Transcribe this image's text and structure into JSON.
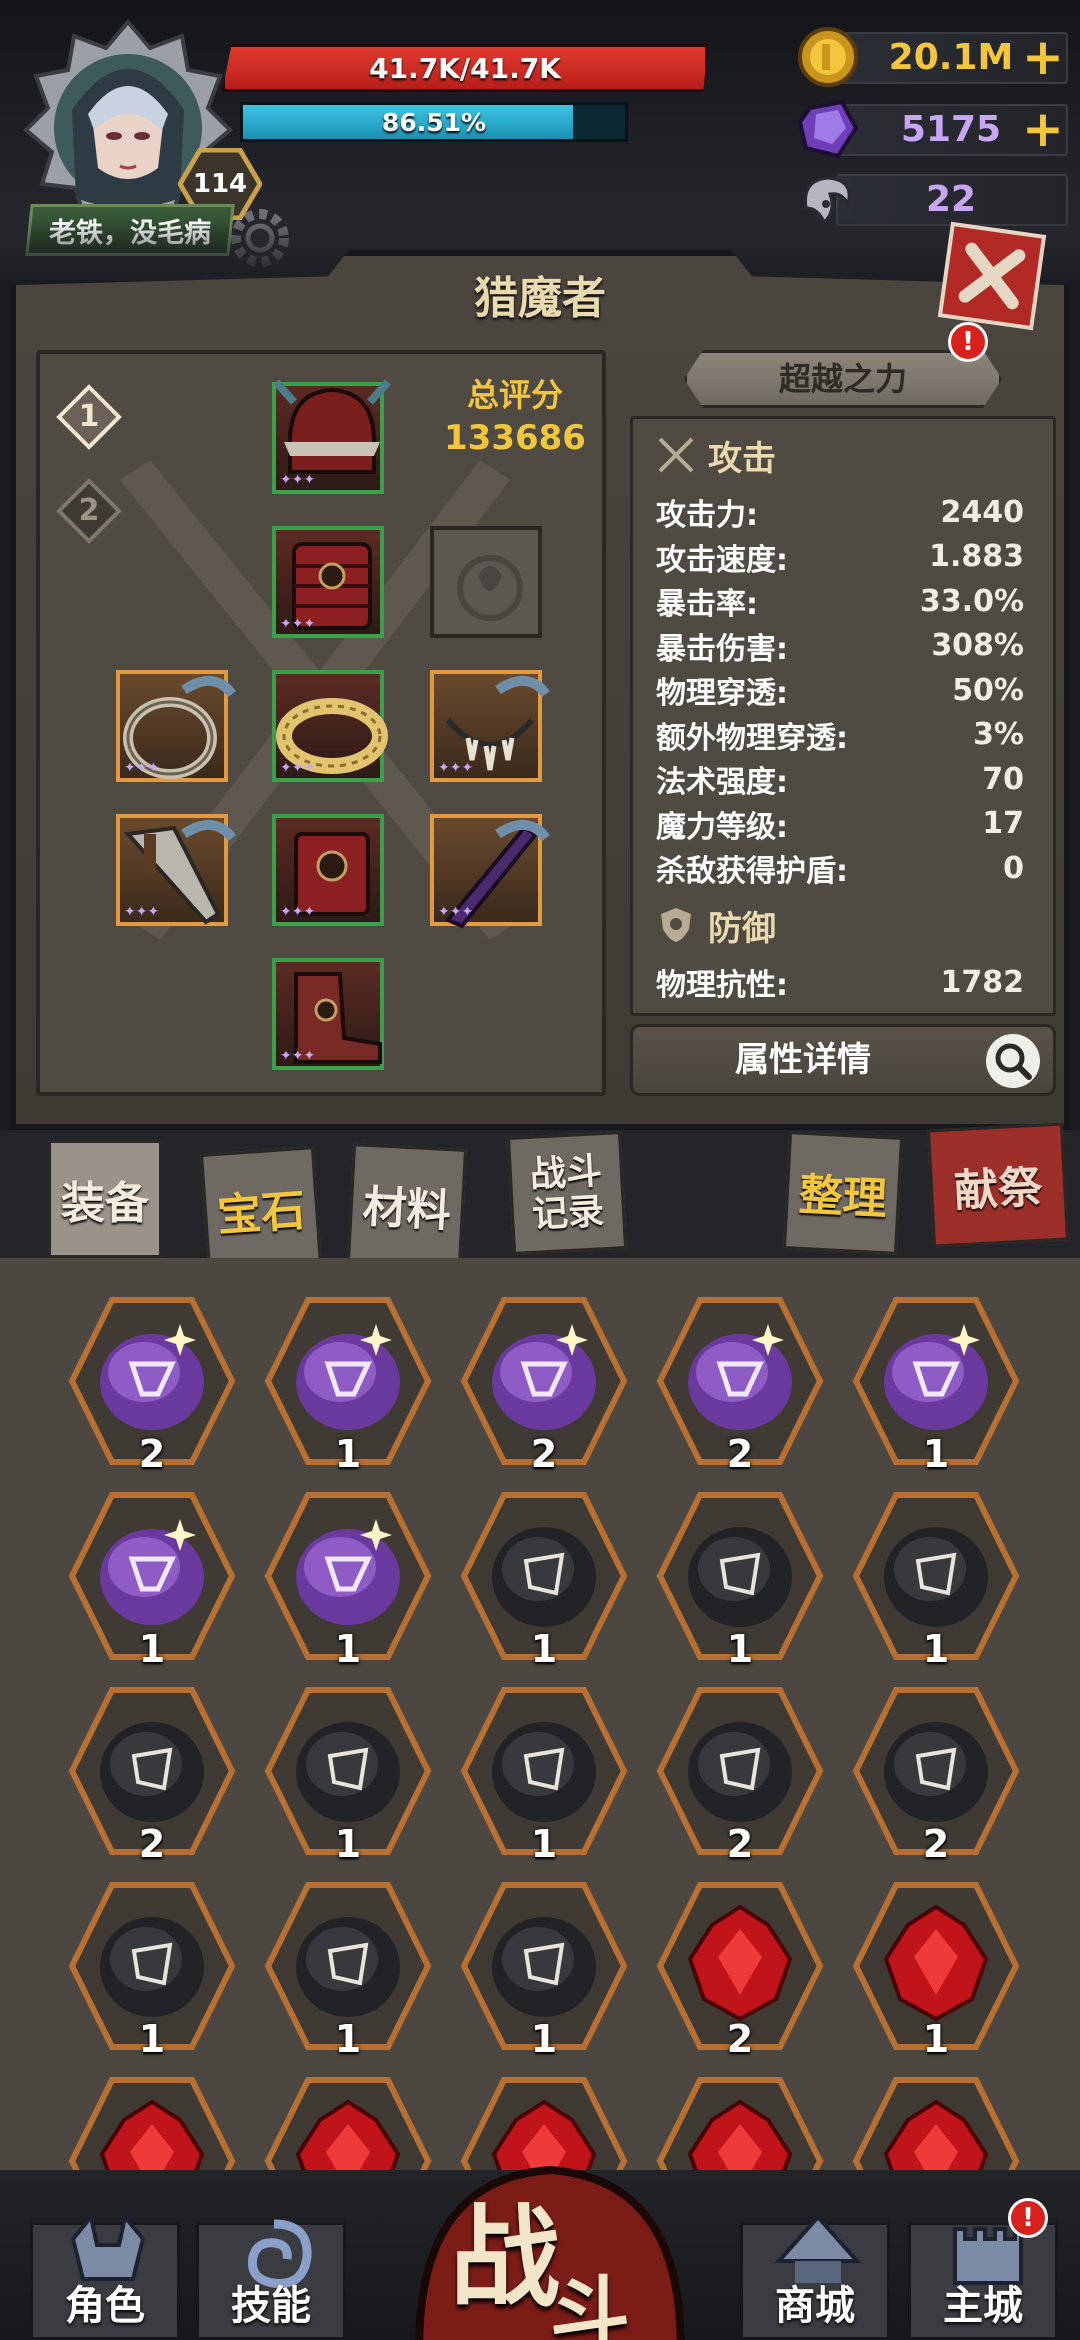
{
  "player": {
    "name": "老铁，没毛病",
    "level": "114",
    "hp_text": "41.7K/41.7K",
    "hp_fraction": 1.0,
    "mp_text": "86.51%",
    "mp_fraction": 0.8651
  },
  "currency": {
    "gold": "20.1M",
    "gems": "5175",
    "horns": "22",
    "plus": "+"
  },
  "panel": {
    "title": "猎魔者",
    "score_label": "总评分",
    "score_value": "133686",
    "loadouts": [
      "1",
      "2"
    ],
    "transcend_label": "超越之力",
    "alert": "!",
    "detail_label": "属性详情"
  },
  "stats": {
    "attack_header": "攻击",
    "attack": [
      {
        "label": "攻击力:",
        "value": "2440"
      },
      {
        "label": "攻击速度:",
        "value": "1.883"
      },
      {
        "label": "暴击率:",
        "value": "33.0%"
      },
      {
        "label": "暴击伤害:",
        "value": "308%"
      },
      {
        "label": "物理穿透:",
        "value": "50%"
      },
      {
        "label": "额外物理穿透:",
        "value": "3%"
      },
      {
        "label": "法术强度:",
        "value": "70"
      },
      {
        "label": "魔力等级:",
        "value": "17"
      },
      {
        "label": "杀敌获得护盾:",
        "value": "0"
      }
    ],
    "defense_header": "防御",
    "defense": [
      {
        "label": "物理抗性:",
        "value": "1782"
      }
    ]
  },
  "tabs": {
    "equipment": "装备",
    "gems": "宝石",
    "materials": "材料",
    "battle_log": "战斗记录",
    "sort": "整理",
    "sacrifice": "献祭"
  },
  "inventory": [
    {
      "kind": "purple",
      "count": "2"
    },
    {
      "kind": "purple",
      "count": "1"
    },
    {
      "kind": "purple",
      "count": "2"
    },
    {
      "kind": "purple",
      "count": "2"
    },
    {
      "kind": "purple",
      "count": "1"
    },
    {
      "kind": "purple",
      "count": "1"
    },
    {
      "kind": "purple",
      "count": "1"
    },
    {
      "kind": "black",
      "count": "1"
    },
    {
      "kind": "black",
      "count": "1"
    },
    {
      "kind": "black",
      "count": "1"
    },
    {
      "kind": "black",
      "count": "2"
    },
    {
      "kind": "black",
      "count": "1"
    },
    {
      "kind": "black",
      "count": "1"
    },
    {
      "kind": "black",
      "count": "2"
    },
    {
      "kind": "black",
      "count": "2"
    },
    {
      "kind": "black",
      "count": "1"
    },
    {
      "kind": "black",
      "count": "1"
    },
    {
      "kind": "black",
      "count": "1"
    },
    {
      "kind": "ruby",
      "count": "2"
    },
    {
      "kind": "ruby",
      "count": "1"
    },
    {
      "kind": "ruby",
      "count": ""
    },
    {
      "kind": "ruby",
      "count": ""
    },
    {
      "kind": "ruby",
      "count": ""
    },
    {
      "kind": "ruby",
      "count": ""
    },
    {
      "kind": "ruby",
      "count": ""
    }
  ],
  "nav": {
    "character": "角色",
    "skills": "技能",
    "fight_1": "战",
    "fight_2": "斗",
    "shop": "商城",
    "castle": "主城",
    "alert": "!"
  },
  "colors": {
    "hp": "#e23a2e",
    "mp": "#3ec4e3",
    "gold": "#f3c63c",
    "gem": "#c9a6f5",
    "rarity_green": "#39a14a",
    "rarity_orange": "#e39a3f"
  }
}
